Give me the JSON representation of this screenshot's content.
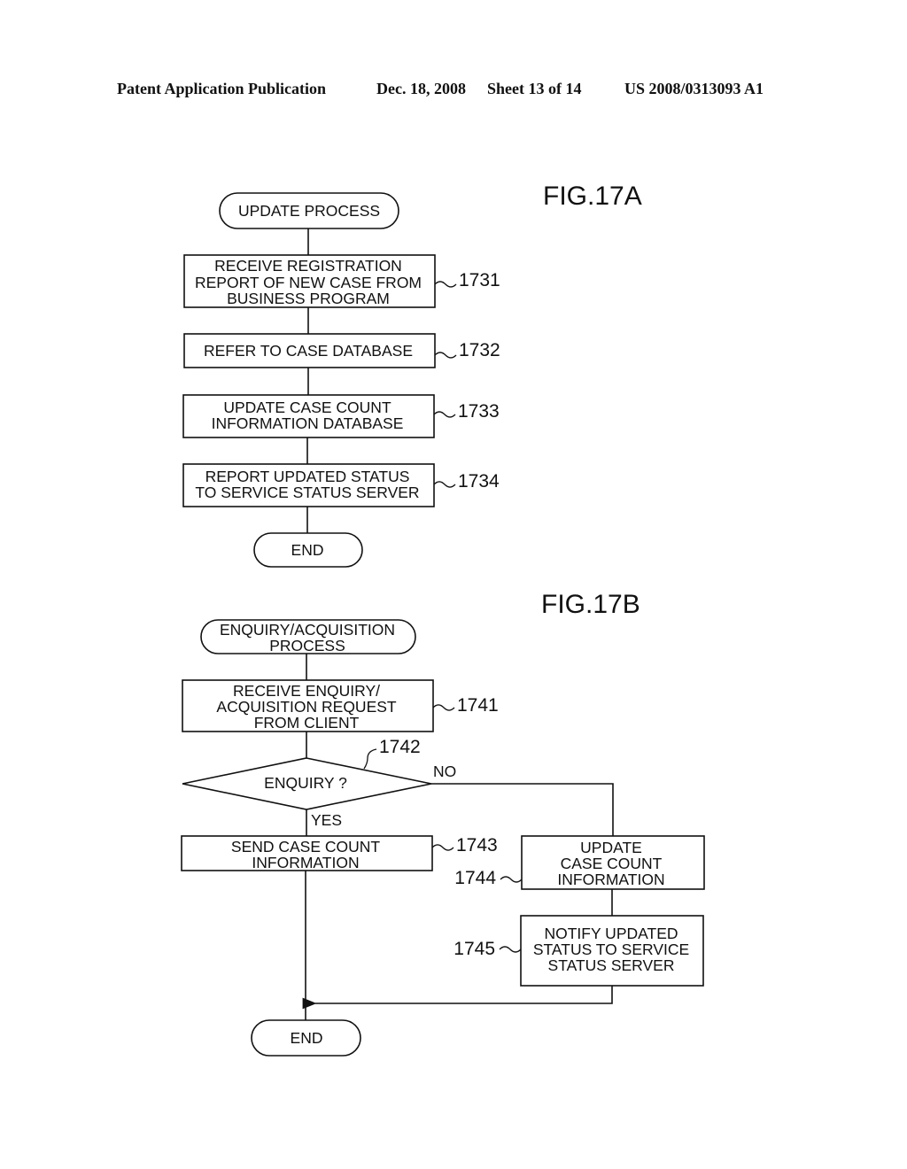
{
  "header": {
    "publication": "Patent Application Publication",
    "date": "Dec. 18, 2008",
    "sheet": "Sheet 13 of 14",
    "number": "US 2008/0313093 A1"
  },
  "fig_a": {
    "label": "FIG.17A",
    "start": "UPDATE PROCESS",
    "steps": [
      {
        "ref": "1731",
        "lines": [
          "RECEIVE REGISTRATION",
          "REPORT OF NEW CASE FROM",
          "BUSINESS PROGRAM"
        ]
      },
      {
        "ref": "1732",
        "lines": [
          "REFER TO CASE DATABASE"
        ]
      },
      {
        "ref": "1733",
        "lines": [
          "UPDATE CASE COUNT",
          "INFORMATION DATABASE"
        ]
      },
      {
        "ref": "1734",
        "lines": [
          "REPORT UPDATED STATUS",
          "TO SERVICE STATUS SERVER"
        ]
      }
    ],
    "end": "END"
  },
  "fig_b": {
    "label": "FIG.17B",
    "start": [
      "ENQUIRY/ACQUISITION",
      "PROCESS"
    ],
    "receive": {
      "ref": "1741",
      "lines": [
        "RECEIVE ENQUIRY/",
        "ACQUISITION REQUEST",
        "FROM CLIENT"
      ]
    },
    "decision": {
      "ref": "1742",
      "text": "ENQUIRY ?",
      "yes": "YES",
      "no": "NO"
    },
    "send": {
      "ref": "1743",
      "lines": [
        "SEND CASE COUNT",
        "INFORMATION"
      ]
    },
    "update": {
      "ref": "1744",
      "lines": [
        "UPDATE",
        "CASE COUNT",
        "INFORMATION"
      ]
    },
    "notify": {
      "ref": "1745",
      "lines": [
        "NOTIFY UPDATED",
        "STATUS TO SERVICE",
        "STATUS SERVER"
      ]
    },
    "end": "END"
  }
}
